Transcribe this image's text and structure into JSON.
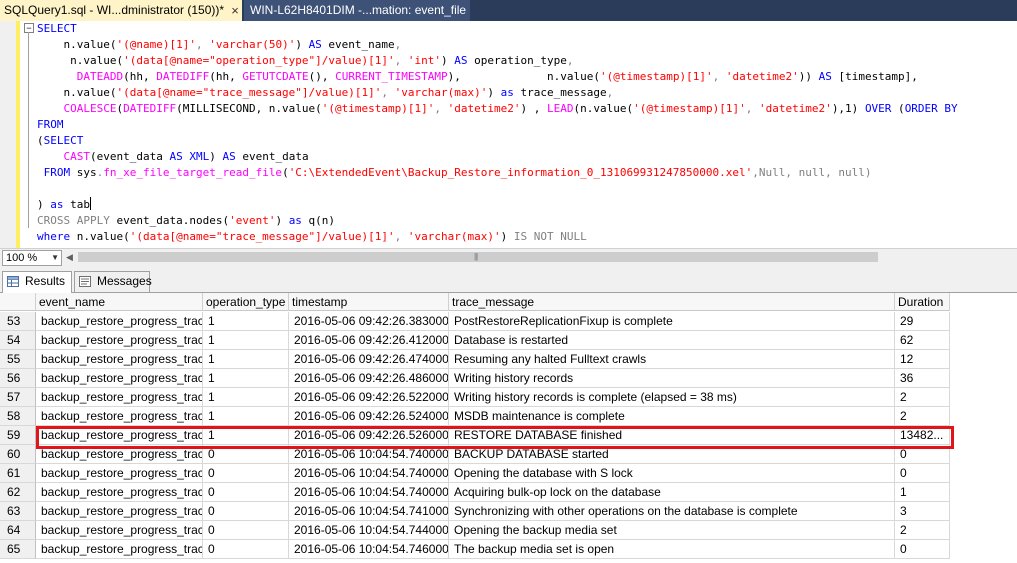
{
  "tabs": {
    "active_label": "SQLQuery1.sql - WI...dministrator (150))*",
    "close_glyph": "×",
    "inactive_label": "WIN-L62H8401DIM -...mation: event_file"
  },
  "editor": {
    "lines": [
      [
        {
          "t": "SELECT",
          "c": "kw"
        }
      ],
      [
        {
          "t": "    n.value(",
          "c": ""
        },
        {
          "t": "'(@name)[1]'",
          "c": "str"
        },
        {
          "t": ", ",
          "c": "gr"
        },
        {
          "t": "'varchar(50)'",
          "c": "str"
        },
        {
          "t": ") ",
          "c": ""
        },
        {
          "t": "AS",
          "c": "kw"
        },
        {
          "t": " event_name",
          "c": ""
        },
        {
          "t": ",",
          "c": "gr"
        }
      ],
      [
        {
          "t": "     n.value(",
          "c": ""
        },
        {
          "t": "'(data[@name=\"operation_type\"]/value)[1]'",
          "c": "str"
        },
        {
          "t": ", ",
          "c": "gr"
        },
        {
          "t": "'int'",
          "c": "str"
        },
        {
          "t": ") ",
          "c": ""
        },
        {
          "t": "AS",
          "c": "kw"
        },
        {
          "t": " operation_type",
          "c": ""
        },
        {
          "t": ",",
          "c": "gr"
        }
      ],
      [
        {
          "t": "      ",
          "c": ""
        },
        {
          "t": "DATEADD",
          "c": "fn"
        },
        {
          "t": "(hh, ",
          "c": ""
        },
        {
          "t": "DATEDIFF",
          "c": "fn"
        },
        {
          "t": "(hh, ",
          "c": ""
        },
        {
          "t": "GETUTCDATE",
          "c": "fn"
        },
        {
          "t": "(), ",
          "c": ""
        },
        {
          "t": "CURRENT_TIMESTAMP",
          "c": "fn"
        },
        {
          "t": "),             n.value(",
          "c": ""
        },
        {
          "t": "'(@timestamp)[1]'",
          "c": "str"
        },
        {
          "t": ", ",
          "c": "gr"
        },
        {
          "t": "'datetime2'",
          "c": "str"
        },
        {
          "t": ")) ",
          "c": ""
        },
        {
          "t": "AS",
          "c": "kw"
        },
        {
          "t": " [timestamp],",
          "c": ""
        }
      ],
      [
        {
          "t": "    n.value(",
          "c": ""
        },
        {
          "t": "'(data[@name=\"trace_message\"]/value)[1]'",
          "c": "str"
        },
        {
          "t": ", ",
          "c": "gr"
        },
        {
          "t": "'varchar(max)'",
          "c": "str"
        },
        {
          "t": ") ",
          "c": ""
        },
        {
          "t": "as",
          "c": "kw"
        },
        {
          "t": " trace_message",
          "c": ""
        },
        {
          "t": ",",
          "c": "gr"
        }
      ],
      [
        {
          "t": "    ",
          "c": ""
        },
        {
          "t": "COALESCE",
          "c": "fn"
        },
        {
          "t": "(",
          "c": ""
        },
        {
          "t": "DATEDIFF",
          "c": "fn"
        },
        {
          "t": "(MILLISECOND, n.value(",
          "c": ""
        },
        {
          "t": "'(@timestamp)[1]'",
          "c": "str"
        },
        {
          "t": ", ",
          "c": "gr"
        },
        {
          "t": "'datetime2'",
          "c": "str"
        },
        {
          "t": ") , ",
          "c": ""
        },
        {
          "t": "LEAD",
          "c": "fn"
        },
        {
          "t": "(n.value(",
          "c": ""
        },
        {
          "t": "'(@timestamp)[1]'",
          "c": "str"
        },
        {
          "t": ", ",
          "c": "gr"
        },
        {
          "t": "'datetime2'",
          "c": "str"
        },
        {
          "t": "),1) ",
          "c": ""
        },
        {
          "t": "OVER",
          "c": "kw"
        },
        {
          "t": " (",
          "c": ""
        },
        {
          "t": "ORDER BY",
          "c": "kw"
        }
      ],
      [
        {
          "t": "FROM",
          "c": "kw"
        }
      ],
      [
        {
          "t": "(",
          "c": ""
        },
        {
          "t": "SELECT",
          "c": "kw"
        }
      ],
      [
        {
          "t": "    ",
          "c": ""
        },
        {
          "t": "CAST",
          "c": "fn"
        },
        {
          "t": "(event_data ",
          "c": ""
        },
        {
          "t": "AS",
          "c": "kw"
        },
        {
          "t": " ",
          "c": ""
        },
        {
          "t": "XML",
          "c": "kw"
        },
        {
          "t": ") ",
          "c": ""
        },
        {
          "t": "AS",
          "c": "kw"
        },
        {
          "t": " event_data",
          "c": ""
        }
      ],
      [
        {
          "t": " ",
          "c": ""
        },
        {
          "t": "FROM",
          "c": "kw"
        },
        {
          "t": " ",
          "c": ""
        },
        {
          "t": "sys",
          "c": ""
        },
        {
          "t": ".",
          "c": "gr"
        },
        {
          "t": "fn_xe_file_target_read_file",
          "c": "fn"
        },
        {
          "t": "(",
          "c": ""
        },
        {
          "t": "'C:\\ExtendedEvent\\Backup_Restore_information_0_131069931247850000.xel'",
          "c": "str"
        },
        {
          "t": ",Null, null, null)",
          "c": "gr"
        }
      ],
      [],
      [
        {
          "t": ") ",
          "c": ""
        },
        {
          "t": "as",
          "c": "kw"
        },
        {
          "t": " tab",
          "c": ""
        },
        {
          "cursor": true
        }
      ],
      [
        {
          "t": "CROSS APPLY",
          "c": "gr"
        },
        {
          "t": " event_data.nodes(",
          "c": ""
        },
        {
          "t": "'event'",
          "c": "str"
        },
        {
          "t": ") ",
          "c": ""
        },
        {
          "t": "as",
          "c": "kw"
        },
        {
          "t": " q(n)",
          "c": ""
        }
      ],
      [
        {
          "t": "where",
          "c": "kw"
        },
        {
          "t": " n.value(",
          "c": ""
        },
        {
          "t": "'(data[@name=\"trace_message\"]/value)[1]'",
          "c": "str"
        },
        {
          "t": ", ",
          "c": "gr"
        },
        {
          "t": "'varchar(max)'",
          "c": "str"
        },
        {
          "t": ") ",
          "c": ""
        },
        {
          "t": "IS NOT NULL",
          "c": "gr"
        }
      ]
    ]
  },
  "toolbar": {
    "zoom_value": "100 %",
    "zoom_dropdown": "▼",
    "scroll_left": "◀",
    "scroll_grip": "|||"
  },
  "results_tabs": {
    "results_label": "Results",
    "messages_label": "Messages"
  },
  "grid": {
    "columns": [
      "event_name",
      "operation_type",
      "timestamp",
      "trace_message",
      "Duration"
    ],
    "rows": [
      [
        "53",
        "backup_restore_progress_trace",
        "1",
        "2016-05-06 09:42:26.3830000",
        "PostRestoreReplicationFixup is complete",
        "29"
      ],
      [
        "54",
        "backup_restore_progress_trace",
        "1",
        "2016-05-06 09:42:26.4120000",
        "Database is restarted",
        "62"
      ],
      [
        "55",
        "backup_restore_progress_trace",
        "1",
        "2016-05-06 09:42:26.4740000",
        "Resuming any halted Fulltext crawls",
        "12"
      ],
      [
        "56",
        "backup_restore_progress_trace",
        "1",
        "2016-05-06 09:42:26.4860000",
        "Writing history records",
        "36"
      ],
      [
        "57",
        "backup_restore_progress_trace",
        "1",
        "2016-05-06 09:42:26.5220000",
        "Writing history records is complete (elapsed = 38 ms)",
        "2"
      ],
      [
        "58",
        "backup_restore_progress_trace",
        "1",
        "2016-05-06 09:42:26.5240000",
        "MSDB maintenance is complete",
        "2"
      ],
      [
        "59",
        "backup_restore_progress_trace",
        "1",
        "2016-05-06 09:42:26.5260000",
        "RESTORE DATABASE finished",
        "13482..."
      ],
      [
        "60",
        "backup_restore_progress_trace",
        "0",
        "2016-05-06 10:04:54.7400000",
        "BACKUP DATABASE started",
        "0"
      ],
      [
        "61",
        "backup_restore_progress_trace",
        "0",
        "2016-05-06 10:04:54.7400000",
        "Opening the database with S lock",
        "0"
      ],
      [
        "62",
        "backup_restore_progress_trace",
        "0",
        "2016-05-06 10:04:54.7400000",
        "Acquiring bulk-op lock on the database",
        "1"
      ],
      [
        "63",
        "backup_restore_progress_trace",
        "0",
        "2016-05-06 10:04:54.7410000",
        "Synchronizing with other operations on the database is complete",
        "3"
      ],
      [
        "64",
        "backup_restore_progress_trace",
        "0",
        "2016-05-06 10:04:54.7440000",
        "Opening the backup media set",
        "2"
      ],
      [
        "65",
        "backup_restore_progress_trace",
        "0",
        "2016-05-06 10:04:54.7460000",
        "The backup media set is open",
        "0"
      ]
    ],
    "highlight_color": "#e0141a"
  }
}
